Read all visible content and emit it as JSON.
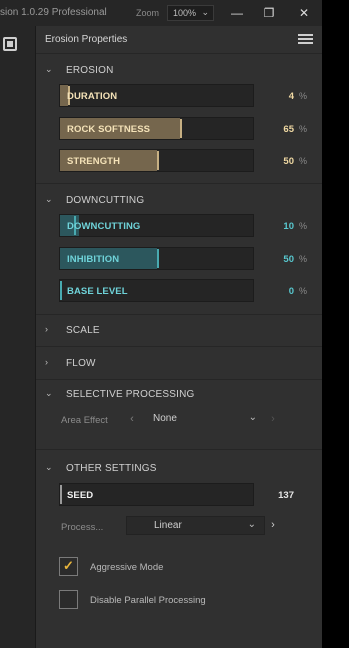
{
  "window": {
    "title": "sion 1.0.29 Professional",
    "zoom_label": "Zoom",
    "zoom_value": "100%"
  },
  "panel": {
    "title": "Erosion Properties"
  },
  "sections": {
    "erosion": {
      "name": "EROSION",
      "duration": {
        "label": "DURATION",
        "value": "4",
        "unit": "%",
        "level": 0.04
      },
      "rock_softness": {
        "label": "ROCK SOFTNESS",
        "value": "65",
        "unit": "%",
        "level": 0.65
      },
      "strength": {
        "label": "STRENGTH",
        "value": "50",
        "unit": "%",
        "level": 0.5
      }
    },
    "downcutting": {
      "name": "DOWNCUTTING",
      "downcutting": {
        "label": "DOWNCUTTING",
        "value": "10",
        "unit": "%",
        "level": 0.1
      },
      "inhibition": {
        "label": "INHIBITION",
        "value": "50",
        "unit": "%",
        "level": 0.5
      },
      "base_level": {
        "label": "BASE LEVEL",
        "value": "0",
        "unit": "%",
        "level": 0.0
      }
    },
    "scale": {
      "name": "SCALE"
    },
    "flow": {
      "name": "FLOW"
    },
    "selective_processing": {
      "name": "SELECTIVE PROCESSING",
      "area_effect_label": "Area Effect",
      "area_effect_value": "None"
    },
    "other_settings": {
      "name": "OTHER SETTINGS",
      "seed": {
        "label": "SEED",
        "value": "137"
      },
      "process_label": "Process...",
      "process_value": "Linear",
      "aggressive_mode": {
        "label": "Aggressive Mode",
        "checked": true
      },
      "disable_parallel": {
        "label": "Disable Parallel Processing",
        "checked": false
      }
    }
  },
  "icons": {
    "expanded": "chevron-down-icon",
    "collapsed": "chevron-right-icon",
    "menu": "hamburger-icon",
    "check": "checkmark-icon"
  },
  "colors": {
    "erosion_accent": "#c7b083",
    "downcutting_accent": "#49aab0",
    "checkbox_accent": "#e8b53c"
  }
}
